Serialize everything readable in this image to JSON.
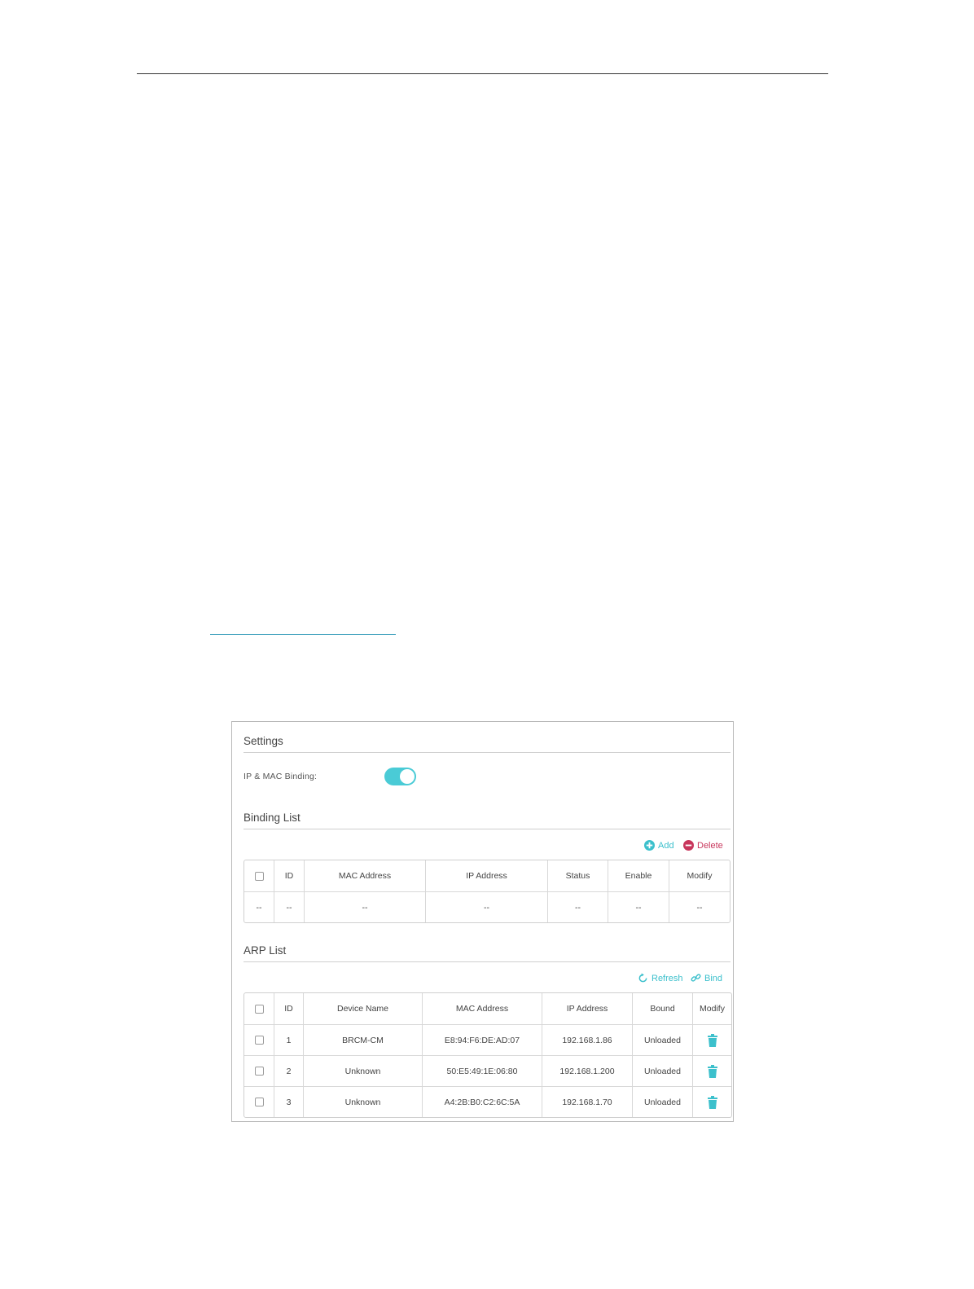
{
  "settings": {
    "title": "Settings",
    "toggle_label": "IP & MAC Binding:",
    "toggle_on": true
  },
  "binding_list": {
    "title": "Binding List",
    "add_label": "Add",
    "delete_label": "Delete",
    "columns": [
      "ID",
      "MAC Address",
      "IP Address",
      "Status",
      "Enable",
      "Modify"
    ],
    "empty_row": [
      "--",
      "--",
      "--",
      "--",
      "--",
      "--",
      "--"
    ]
  },
  "arp_list": {
    "title": "ARP List",
    "refresh_label": "Refresh",
    "bind_label": "Bind",
    "columns": [
      "ID",
      "Device Name",
      "MAC Address",
      "IP Address",
      "Bound",
      "Modify"
    ],
    "rows": [
      {
        "id": "1",
        "device": "BRCM-CM",
        "mac": "E8:94:F6:DE:AD:07",
        "ip": "192.168.1.86",
        "bound": "Unloaded"
      },
      {
        "id": "2",
        "device": "Unknown",
        "mac": "50:E5:49:1E:06:80",
        "ip": "192.168.1.200",
        "bound": "Unloaded"
      },
      {
        "id": "3",
        "device": "Unknown",
        "mac": "A4:2B:B0:C2:6C:5A",
        "ip": "192.168.1.70",
        "bound": "Unloaded"
      }
    ]
  },
  "colors": {
    "accent": "#4acbd6",
    "danger": "#c8365c"
  },
  "icons": [
    "add-icon",
    "delete-icon",
    "refresh-icon",
    "bind-icon",
    "trash-icon"
  ]
}
